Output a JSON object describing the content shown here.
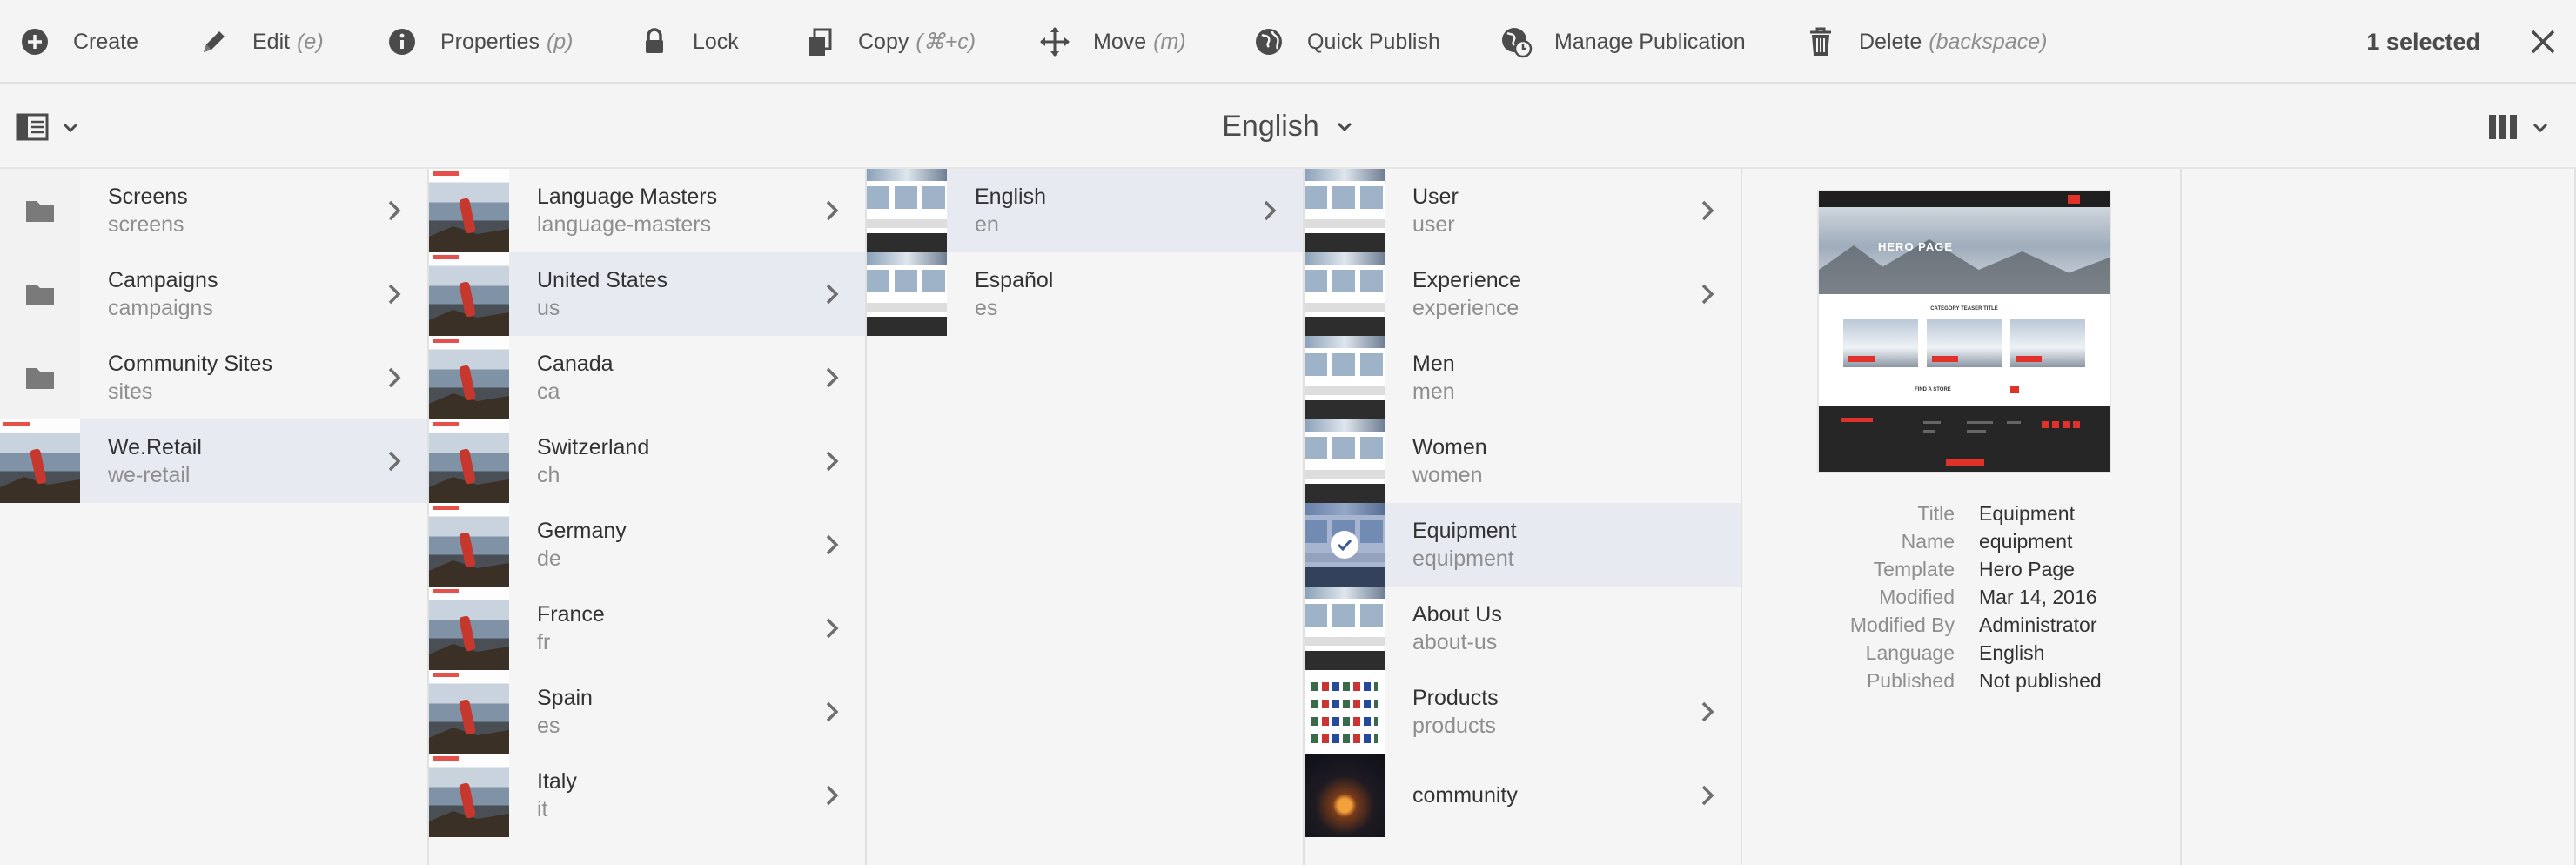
{
  "actionbar": {
    "actions": [
      {
        "label": "Create",
        "shortcut": "",
        "icon": "plus-circle-icon"
      },
      {
        "label": "Edit",
        "shortcut": "(e)",
        "icon": "pencil-icon"
      },
      {
        "label": "Properties",
        "shortcut": "(p)",
        "icon": "info-circle-icon"
      },
      {
        "label": "Lock",
        "shortcut": "",
        "icon": "lock-icon"
      },
      {
        "label": "Copy",
        "shortcut": "(⌘+c)",
        "icon": "copy-icon"
      },
      {
        "label": "Move",
        "shortcut": "(m)",
        "icon": "move-icon"
      },
      {
        "label": "Quick Publish",
        "shortcut": "",
        "icon": "globe-icon"
      },
      {
        "label": "Manage Publication",
        "shortcut": "",
        "icon": "globe-clock-icon"
      },
      {
        "label": "Delete",
        "shortcut": "(backspace)",
        "icon": "trash-icon"
      }
    ],
    "selection_count": "1 selected",
    "close_icon": "close-icon"
  },
  "titlebar": {
    "title": "English",
    "rail_toggle_icon": "rail-toggle-icon",
    "view_switcher_icon": "column-view-icon"
  },
  "columns": [
    {
      "items": [
        {
          "title": "Screens",
          "name": "screens",
          "thumb": "folder",
          "has_children": true,
          "selected": false
        },
        {
          "title": "Campaigns",
          "name": "campaigns",
          "thumb": "folder",
          "has_children": true,
          "selected": false
        },
        {
          "title": "Community Sites",
          "name": "sites",
          "thumb": "folder",
          "has_children": true,
          "selected": false
        },
        {
          "title": "We.Retail",
          "name": "we-retail",
          "thumb": "hero",
          "has_children": true,
          "selected": true
        }
      ]
    },
    {
      "items": [
        {
          "title": "Language Masters",
          "name": "language-masters",
          "thumb": "hero",
          "has_children": true,
          "selected": false
        },
        {
          "title": "United States",
          "name": "us",
          "thumb": "hero",
          "has_children": true,
          "selected": true
        },
        {
          "title": "Canada",
          "name": "ca",
          "thumb": "hero",
          "has_children": true,
          "selected": false
        },
        {
          "title": "Switzerland",
          "name": "ch",
          "thumb": "hero",
          "has_children": true,
          "selected": false
        },
        {
          "title": "Germany",
          "name": "de",
          "thumb": "hero",
          "has_children": true,
          "selected": false
        },
        {
          "title": "France",
          "name": "fr",
          "thumb": "hero",
          "has_children": true,
          "selected": false
        },
        {
          "title": "Spain",
          "name": "es",
          "thumb": "hero",
          "has_children": true,
          "selected": false
        },
        {
          "title": "Italy",
          "name": "it",
          "thumb": "hero",
          "has_children": true,
          "selected": false
        }
      ]
    },
    {
      "items": [
        {
          "title": "English",
          "name": "en",
          "thumb": "site",
          "has_children": true,
          "selected": true
        },
        {
          "title": "Español",
          "name": "es",
          "thumb": "site",
          "has_children": false,
          "selected": false
        }
      ]
    },
    {
      "items": [
        {
          "title": "User",
          "name": "user",
          "thumb": "site",
          "has_children": true,
          "selected": false
        },
        {
          "title": "Experience",
          "name": "experience",
          "thumb": "site",
          "has_children": true,
          "selected": false
        },
        {
          "title": "Men",
          "name": "men",
          "thumb": "site",
          "has_children": false,
          "selected": false
        },
        {
          "title": "Women",
          "name": "women",
          "thumb": "site",
          "has_children": false,
          "selected": false
        },
        {
          "title": "Equipment",
          "name": "equipment",
          "thumb": "site",
          "has_children": false,
          "selected": true,
          "checked": true
        },
        {
          "title": "About Us",
          "name": "about-us",
          "thumb": "site",
          "has_children": false,
          "selected": false
        },
        {
          "title": "Products",
          "name": "products",
          "thumb": "products",
          "has_children": true,
          "selected": false
        },
        {
          "title": "community",
          "name": "",
          "thumb": "community",
          "has_children": true,
          "selected": false
        }
      ]
    }
  ],
  "preview": {
    "thumbnail": {
      "hero_text": "HERO PAGE",
      "teaser_text": "CATEGORY TEASER TITLE",
      "store_text": "FIND A STORE"
    },
    "meta": [
      {
        "key": "Title",
        "value": "Equipment"
      },
      {
        "key": "Name",
        "value": "equipment"
      },
      {
        "key": "Template",
        "value": "Hero Page"
      },
      {
        "key": "Modified",
        "value": "Mar 14, 2016"
      },
      {
        "key": "Modified By",
        "value": "Administrator"
      },
      {
        "key": "Language",
        "value": "English"
      },
      {
        "key": "Published",
        "value": "Not published"
      }
    ]
  },
  "colors": {
    "accent_red": "#e0312b",
    "selected_row": "#e7eaf0",
    "text_primary": "#323232",
    "text_secondary": "#8e8e8e"
  }
}
